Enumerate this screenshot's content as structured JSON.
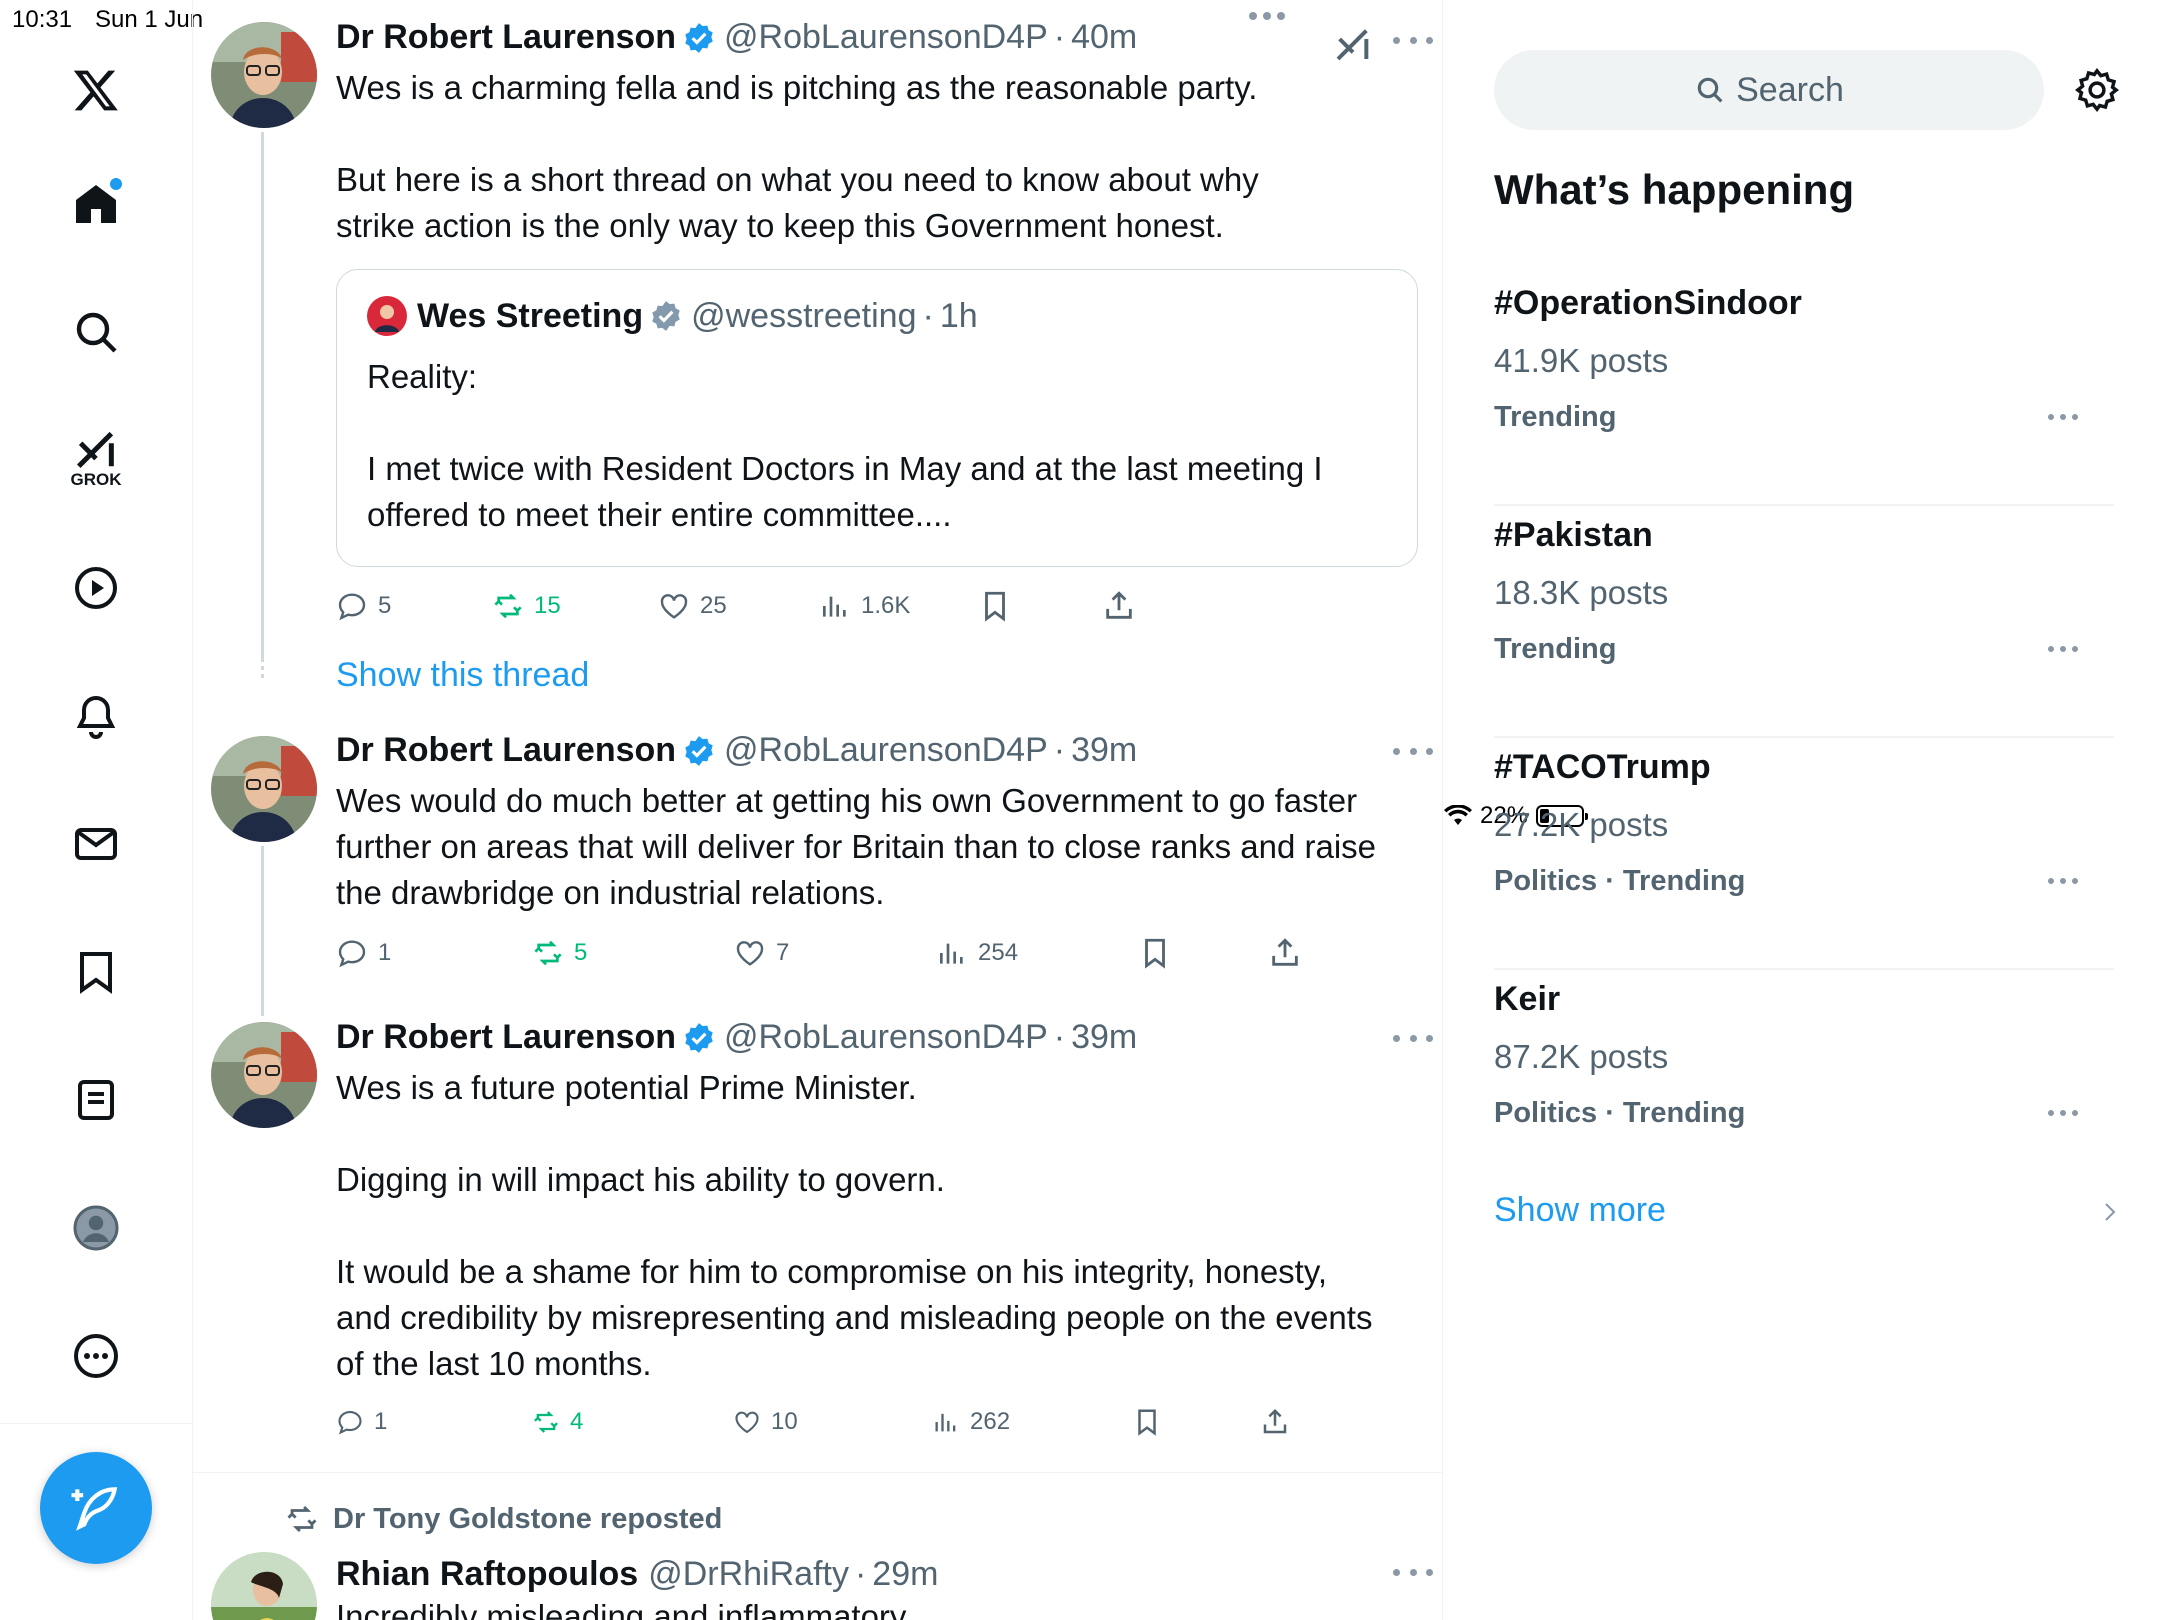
{
  "status_bar": {
    "time": "10:31",
    "date": "Sun 1 Jun",
    "battery": "22%",
    "battery_level": 0.22
  },
  "sidebar": {
    "items": [
      {
        "icon": "x-logo-icon"
      },
      {
        "icon": "home-icon"
      },
      {
        "icon": "search-icon"
      },
      {
        "icon": "grok-icon",
        "label": "GROK"
      },
      {
        "icon": "video-icon"
      },
      {
        "icon": "notifications-icon"
      },
      {
        "icon": "messages-icon"
      },
      {
        "icon": "bookmarks-icon"
      },
      {
        "icon": "lists-icon"
      },
      {
        "icon": "profile-icon"
      },
      {
        "icon": "more-icon"
      }
    ],
    "compose_icon": "compose-icon"
  },
  "tweets": [
    {
      "name": "Dr Robert Laurenson",
      "handle": "@RobLaurensonD4P",
      "time": "40m",
      "paragraphs": [
        "Wes is a charming fella and is pitching as the reasonable party.",
        "",
        "But here is a short thread on what you need to know about why strike action is the only way to keep this Government honest."
      ],
      "quote": {
        "name": "Wes Streeting",
        "handle": "@wesstreeting",
        "time": "1h",
        "paragraphs": [
          "Reality:",
          "",
          "I met twice with Resident Doctors in May and at the last meeting I offered to meet their entire committee...."
        ]
      },
      "stats": {
        "replies": "5",
        "reposts": "15",
        "likes": "25",
        "views": "1.6K"
      }
    },
    {
      "name": "Dr Robert Laurenson",
      "handle": "@RobLaurensonD4P",
      "time": "39m",
      "paragraphs": [
        "Wes would do much better at getting his own Government to go faster further on areas that will deliver for Britain than to close ranks and raise the drawbridge on industrial relations."
      ],
      "stats": {
        "replies": "1",
        "reposts": "5",
        "likes": "7",
        "views": "254"
      }
    },
    {
      "name": "Dr Robert Laurenson",
      "handle": "@RobLaurensonD4P",
      "time": "39m",
      "paragraphs": [
        "Wes is a future potential Prime Minister.",
        "",
        "Digging in will impact his ability to govern.",
        "",
        "It would be a shame for him to compromise on his integrity, honesty, and credibility by misrepresenting and misleading people on the events of the last 10 months."
      ],
      "stats": {
        "replies": "1",
        "reposts": "4",
        "likes": "10",
        "views": "262"
      }
    },
    {
      "reposted_by": "Dr Tony Goldstone reposted",
      "name": "Rhian Raftopoulos",
      "handle": "@DrRhiRafty",
      "time": "29m",
      "paragraphs": [
        "Incredibly misleading and inflammatory"
      ]
    }
  ],
  "show_thread": "Show this thread",
  "right": {
    "search_placeholder": "Search",
    "heading": "What’s happening",
    "trends": [
      {
        "tag": "#OperationSindoor",
        "posts": "41.9K posts",
        "category": "Trending"
      },
      {
        "tag": "#Pakistan",
        "posts": "18.3K posts",
        "category": "Trending"
      },
      {
        "tag": "#TACOTrump",
        "posts": "27.2K posts",
        "category": "Politics · Trending"
      },
      {
        "tag": "Keir",
        "posts": "87.2K posts",
        "category": "Politics · Trending"
      }
    ],
    "show_more": "Show more"
  },
  "colors": {
    "accent": "#1d9bf0",
    "repost_green": "#00ba7c",
    "muted": "#536471",
    "border": "#eff3f4"
  }
}
